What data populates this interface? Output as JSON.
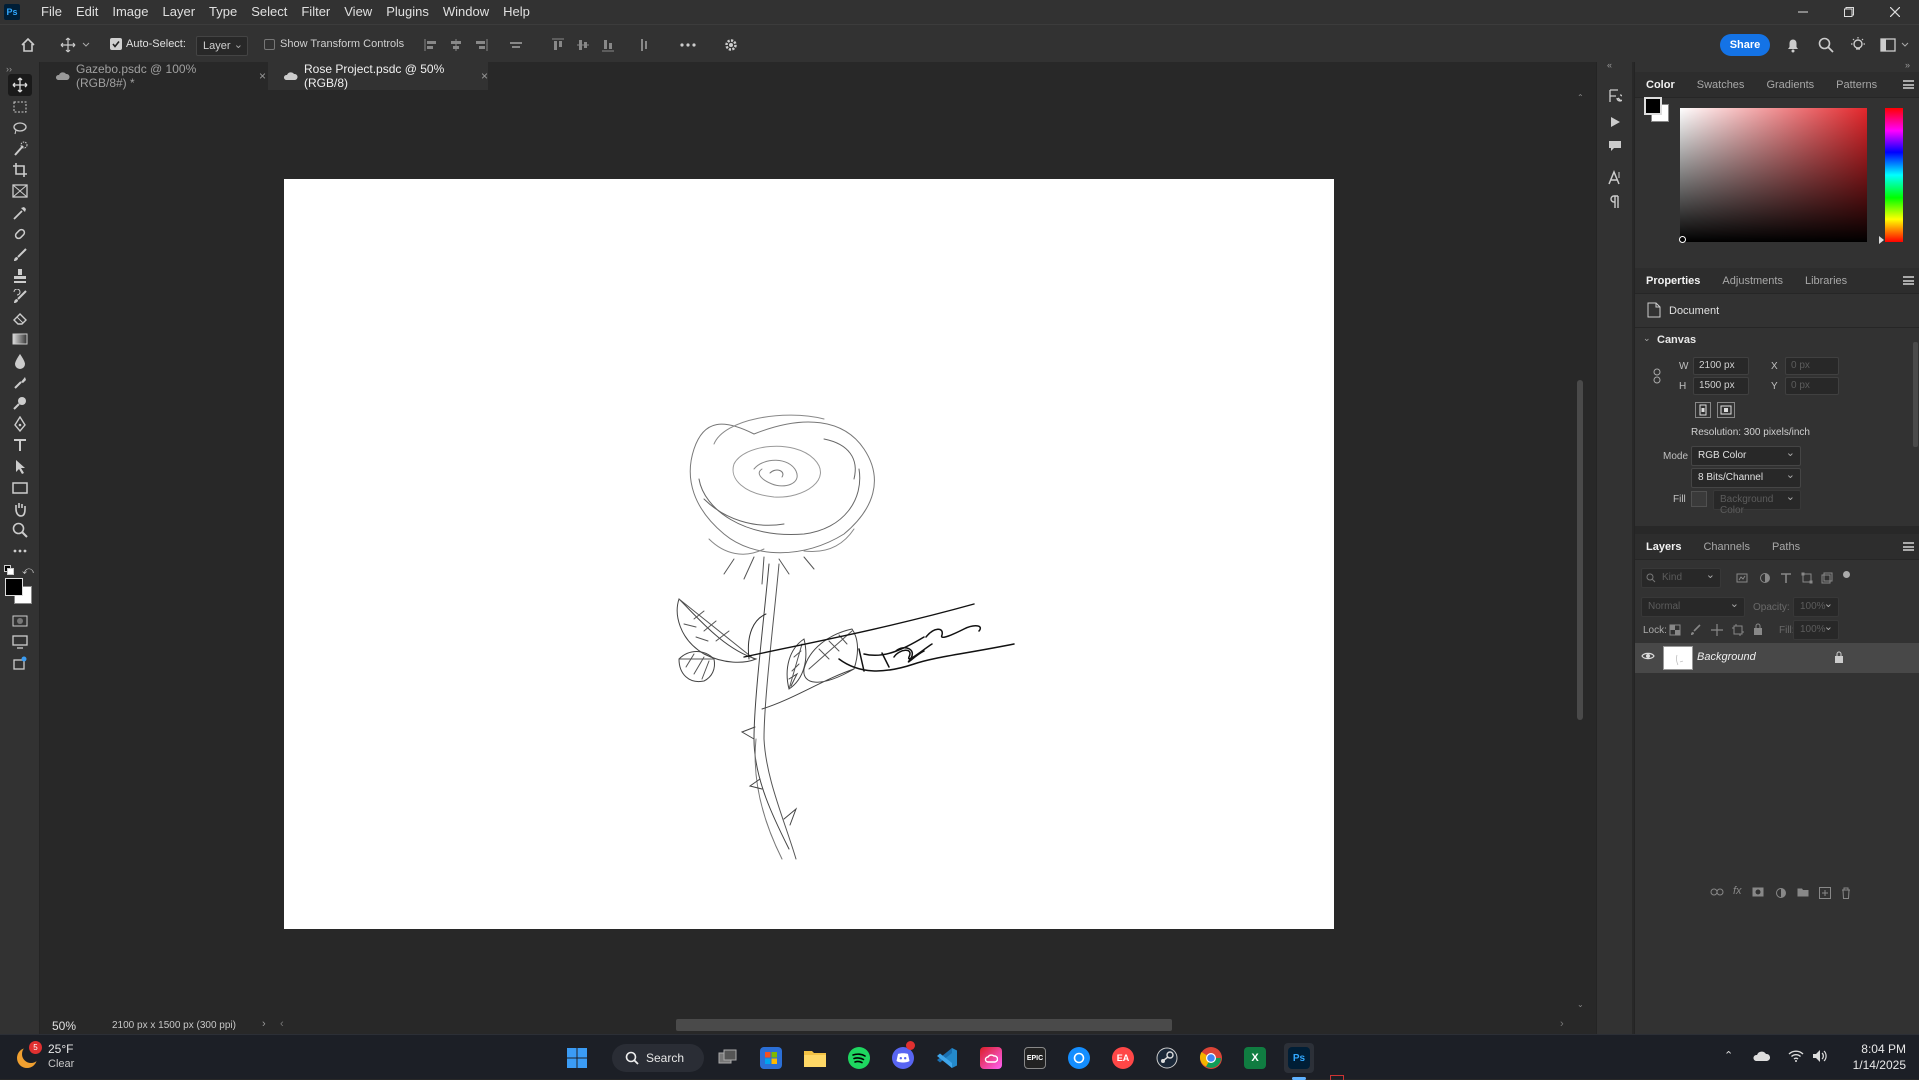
{
  "menubar": {
    "logo": "Ps",
    "items": [
      "File",
      "Edit",
      "Image",
      "Layer",
      "Type",
      "Select",
      "Filter",
      "View",
      "Plugins",
      "Window",
      "Help"
    ]
  },
  "options": {
    "auto_select_label": "Auto-Select:",
    "auto_select_checked": true,
    "auto_select_value": "Layer",
    "transform_controls_label": "Show Transform Controls",
    "share_label": "Share"
  },
  "tabs": [
    {
      "label": "Gazebo.psdc @ 100% (RGB/8#) *",
      "active": false
    },
    {
      "label": "Rose Project.psdc @ 50% (RGB/8)",
      "active": true
    }
  ],
  "status": {
    "zoom": "50%",
    "doc_info": "2100 px x 1500 px (300 ppi)"
  },
  "color_panel": {
    "tabs": [
      "Color",
      "Swatches",
      "Gradients",
      "Patterns"
    ],
    "active_tab": "Color",
    "foreground": "#000000",
    "background": "#ffffff",
    "hue_color": "#e3262b"
  },
  "properties_panel": {
    "tabs": [
      "Properties",
      "Adjustments",
      "Libraries"
    ],
    "active_tab": "Properties",
    "doc_label": "Document",
    "section": "Canvas",
    "w_label": "W",
    "w_value": "2100 px",
    "h_label": "H",
    "h_value": "1500 px",
    "x_label": "X",
    "x_value": "0 px",
    "y_label": "Y",
    "y_value": "0 px",
    "resolution": "Resolution: 300 pixels/inch",
    "mode_label": "Mode",
    "mode_value": "RGB Color",
    "bits_value": "8 Bits/Channel",
    "fill_label": "Fill",
    "fill_value": "Background Color"
  },
  "layers_panel": {
    "tabs": [
      "Layers",
      "Channels",
      "Paths"
    ],
    "active_tab": "Layers",
    "filter_placeholder": "Kind",
    "blend_mode": "Normal",
    "opacity_label": "Opacity:",
    "opacity_value": "100%",
    "lock_label": "Lock:",
    "fill_label": "Fill:",
    "fill_value": "100%",
    "layers": [
      {
        "name": "Background",
        "visible": true,
        "locked": true
      }
    ]
  },
  "taskbar": {
    "weather_temp": "25°F",
    "weather_cond": "Clear",
    "weather_badge": "5",
    "search_label": "Search",
    "time": "8:04 PM",
    "date": "1/14/2025"
  }
}
